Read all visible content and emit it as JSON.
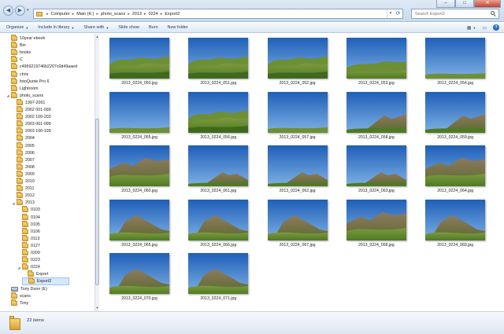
{
  "address": {
    "crumbs": [
      "Computer",
      "Main (K:)",
      "photo_scans",
      "2013",
      "0224",
      "Export2"
    ]
  },
  "search": {
    "placeholder": "Search Export2"
  },
  "toolbar": {
    "organize": "Organize",
    "include": "Include in library",
    "share": "Share with",
    "slideshow": "Slide show",
    "burn": "Burn",
    "newfolder": "New folder"
  },
  "tree": [
    {
      "label": "10year ebook",
      "level": 0,
      "expander": ""
    },
    {
      "label": "Bin",
      "level": 0,
      "expander": ""
    },
    {
      "label": "books",
      "level": 0,
      "expander": ""
    },
    {
      "label": "C",
      "level": 0,
      "expander": ""
    },
    {
      "label": "c4959219746b2207c0d49aaed",
      "level": 0,
      "expander": ""
    },
    {
      "label": "chris",
      "level": 0,
      "expander": ""
    },
    {
      "label": "fotoQuote Pro 6",
      "level": 0,
      "expander": ""
    },
    {
      "label": "Lightroom",
      "level": 0,
      "expander": ""
    },
    {
      "label": "photo_scans",
      "level": 0,
      "expander": "open"
    },
    {
      "label": "1997-2001",
      "level": 1,
      "expander": ""
    },
    {
      "label": "2002 001-099",
      "level": 1,
      "expander": ""
    },
    {
      "label": "2002 100-203",
      "level": 1,
      "expander": ""
    },
    {
      "label": "2003 001-099",
      "level": 1,
      "expander": ""
    },
    {
      "label": "2003 100-199",
      "level": 1,
      "expander": ""
    },
    {
      "label": "2004",
      "level": 1,
      "expander": ""
    },
    {
      "label": "2005",
      "level": 1,
      "expander": ""
    },
    {
      "label": "2006",
      "level": 1,
      "expander": ""
    },
    {
      "label": "2007",
      "level": 1,
      "expander": ""
    },
    {
      "label": "2008",
      "level": 1,
      "expander": ""
    },
    {
      "label": "2009",
      "level": 1,
      "expander": ""
    },
    {
      "label": "2010",
      "level": 1,
      "expander": ""
    },
    {
      "label": "2011",
      "level": 1,
      "expander": ""
    },
    {
      "label": "2012",
      "level": 1,
      "expander": ""
    },
    {
      "label": "2013",
      "level": 1,
      "expander": "open"
    },
    {
      "label": "0103",
      "level": 2,
      "expander": ""
    },
    {
      "label": "0104",
      "level": 2,
      "expander": ""
    },
    {
      "label": "0105",
      "level": 2,
      "expander": ""
    },
    {
      "label": "0106",
      "level": 2,
      "expander": ""
    },
    {
      "label": "0113",
      "level": 2,
      "expander": ""
    },
    {
      "label": "0127",
      "level": 2,
      "expander": ""
    },
    {
      "label": "0209",
      "level": 2,
      "expander": ""
    },
    {
      "label": "0223",
      "level": 2,
      "expander": ""
    },
    {
      "label": "0224",
      "level": 2,
      "expander": "open"
    },
    {
      "label": "Export",
      "level": 3,
      "expander": ""
    },
    {
      "label": "Export2",
      "level": 3,
      "expander": "",
      "selected": true
    },
    {
      "label": "Tony Dunn (E)",
      "level": 0,
      "expander": "",
      "drive": true
    },
    {
      "label": "scans",
      "level": 0,
      "expander": ""
    },
    {
      "label": "Tony",
      "level": 0,
      "expander": ""
    }
  ],
  "files": [
    {
      "name": "2013_0224_050.jpg",
      "style": "hills"
    },
    {
      "name": "2013_0224_051.jpg",
      "style": "hills"
    },
    {
      "name": "2013_0224_052.jpg",
      "style": "hills"
    },
    {
      "name": "2013_0224_053.jpg",
      "style": "hillslow"
    },
    {
      "name": "2013_0224_054.jpg",
      "style": "sky"
    },
    {
      "name": "2013_0224_055.jpg",
      "style": "sky"
    },
    {
      "name": "2013_0224_056.jpg",
      "style": "hills"
    },
    {
      "name": "2013_0224_057.jpg",
      "style": "sky"
    },
    {
      "name": "2013_0224_058.jpg",
      "style": "skyridge"
    },
    {
      "name": "2013_0224_059.jpg",
      "style": "skyridge"
    },
    {
      "name": "2013_0224_060.jpg",
      "style": "ridge"
    },
    {
      "name": "2013_0224_061.jpg",
      "style": "skypeak"
    },
    {
      "name": "2013_0224_062.jpg",
      "style": "skypeak"
    },
    {
      "name": "2013_0224_063.jpg",
      "style": "skypeak"
    },
    {
      "name": "2013_0224_064.jpg",
      "style": "ridge"
    },
    {
      "name": "2013_0224_065.jpg",
      "style": "peak"
    },
    {
      "name": "2013_0224_066.jpg",
      "style": "peak"
    },
    {
      "name": "2013_0224_067.jpg",
      "style": "peak"
    },
    {
      "name": "2013_0224_068.jpg",
      "style": "ridge"
    },
    {
      "name": "2013_0224_069.jpg",
      "style": "peak"
    },
    {
      "name": "2013_0224_070.jpg",
      "style": "peak"
    },
    {
      "name": "2013_0224_071.jpg",
      "style": "peak"
    }
  ],
  "status": {
    "count": "22 items"
  }
}
